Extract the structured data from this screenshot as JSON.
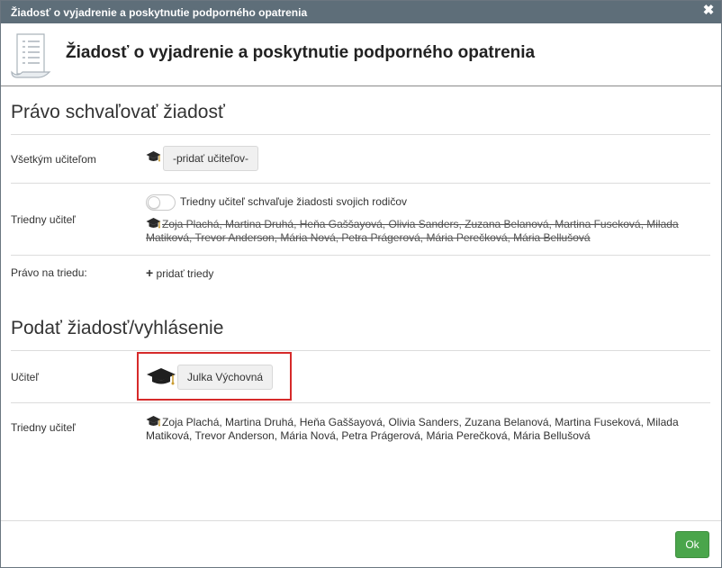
{
  "window": {
    "title": "Žiadosť o vyjadrenie a poskytnutie podporného opatrenia",
    "close_symbol": "✖"
  },
  "header": {
    "icon": "document-icon",
    "heading": "Žiadosť o vyjadrenie a poskytnutie podporného opatrenia"
  },
  "approval": {
    "section_title": "Právo schvaľovať žiadosť",
    "all_teachers_label": "Všetkým učiteľom",
    "add_teachers_button": "-pridať učiteľov-",
    "class_teacher_label": "Triedny učiteľ",
    "toggle_label": "Triedny učiteľ schvaľuje žiadosti svojich rodičov",
    "toggle_on": false,
    "class_teachers_line1": "Zoja Plachá, Martina Druhá, Heňa Gaššayová, Olivia Sanders, Zuzana Belanová, Martina Fuseková, Milada",
    "class_teachers_line2": "Matiková, Trevor Anderson, Mária Nová, Petra Prágerová, Mária Perečková, Mária Bellušová",
    "class_right_label": "Právo na triedu:",
    "add_class_link": "pridať triedy"
  },
  "submit": {
    "section_title": "Podať žiadosť/vyhlásenie",
    "teacher_label": "Učiteľ",
    "teacher_button": "Julka Výchovná",
    "class_teacher_label": "Triedny učiteľ",
    "class_teachers_line1": "Zoja Plachá, Martina Druhá, Heňa Gaššayová, Olivia Sanders, Zuzana Belanová, Martina Fuseková, Milada",
    "class_teachers_line2": "Matiková, Trevor Anderson, Mária Nová, Petra Prágerová, Mária Perečková, Mária Bellušová"
  },
  "footer": {
    "ok_button": "Ok"
  },
  "colors": {
    "titlebar": "#5e6e79",
    "highlight": "#d62a2a",
    "ok_button": "#4aa54b"
  }
}
